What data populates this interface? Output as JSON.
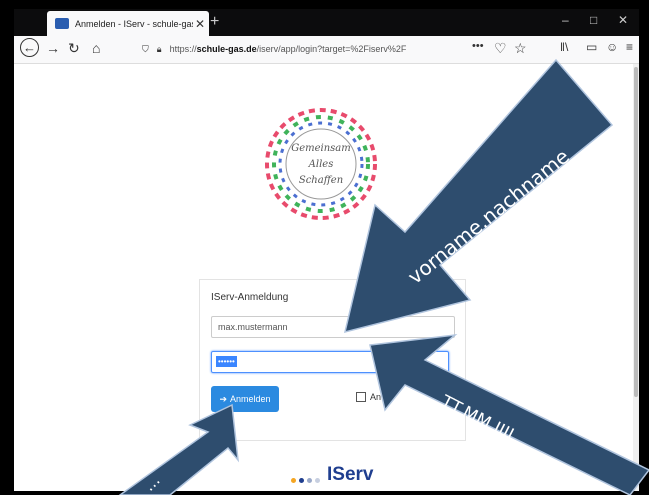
{
  "browser": {
    "tab_title": "Anmelden - IServ - schule-gas.",
    "url_prefix": "https://",
    "url_domain": "schule-gas.de",
    "url_path": "/iserv/app/login?target=%2Fiserv%2F",
    "icons": [
      "back-icon",
      "forward-icon",
      "reload-icon",
      "home-icon",
      "shield-icon",
      "lock-icon",
      "more-icon",
      "pocket-icon",
      "bookmark-icon",
      "library-icon",
      "sidebar-icon",
      "account-icon",
      "menu-icon"
    ]
  },
  "logo": {
    "line1": "Gemeinsam",
    "line2": "Alles",
    "line3": "Schaffen"
  },
  "login": {
    "heading": "IServ-Anmeldung",
    "username_value": "max.mustermann",
    "password_mask": "••••••",
    "submit_label": "Anmelden",
    "remember_label": "An"
  },
  "footer": {
    "brand": "IServ",
    "dot_colors": [
      "#f5a623",
      "#1f3e8f",
      "#9aa9c9",
      "#c7cfe0"
    ]
  },
  "annotations": {
    "arrow_color": "#2e4d6e",
    "username_hint": "vorname.nachname",
    "password_hint": "TT.MM.JJJJ",
    "button_hint": "..."
  }
}
